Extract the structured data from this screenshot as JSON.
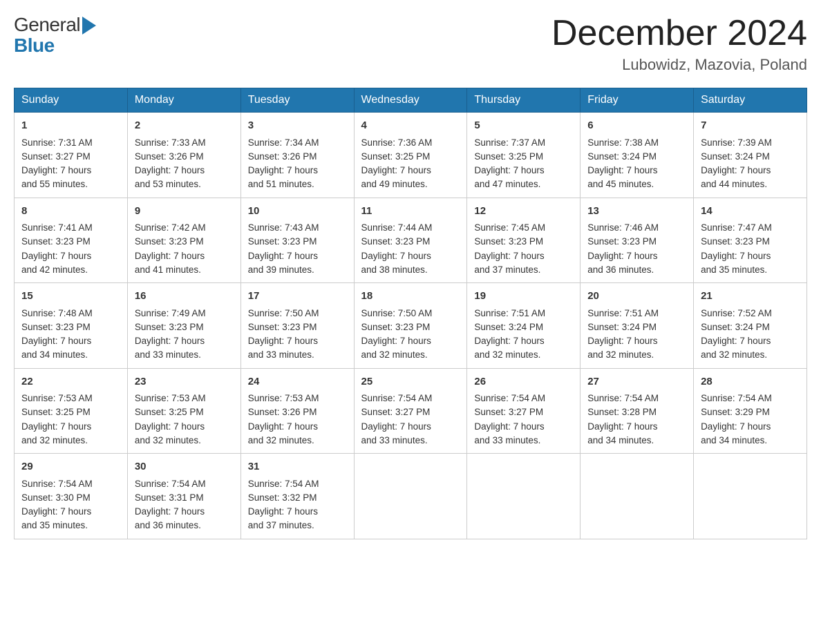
{
  "header": {
    "logo_general": "General",
    "logo_blue": "Blue",
    "month_title": "December 2024",
    "location": "Lubowidz, Mazovia, Poland"
  },
  "days_of_week": [
    "Sunday",
    "Monday",
    "Tuesday",
    "Wednesday",
    "Thursday",
    "Friday",
    "Saturday"
  ],
  "weeks": [
    [
      {
        "day": "1",
        "sunrise": "7:31 AM",
        "sunset": "3:27 PM",
        "daylight": "7 hours and 55 minutes."
      },
      {
        "day": "2",
        "sunrise": "7:33 AM",
        "sunset": "3:26 PM",
        "daylight": "7 hours and 53 minutes."
      },
      {
        "day": "3",
        "sunrise": "7:34 AM",
        "sunset": "3:26 PM",
        "daylight": "7 hours and 51 minutes."
      },
      {
        "day": "4",
        "sunrise": "7:36 AM",
        "sunset": "3:25 PM",
        "daylight": "7 hours and 49 minutes."
      },
      {
        "day": "5",
        "sunrise": "7:37 AM",
        "sunset": "3:25 PM",
        "daylight": "7 hours and 47 minutes."
      },
      {
        "day": "6",
        "sunrise": "7:38 AM",
        "sunset": "3:24 PM",
        "daylight": "7 hours and 45 minutes."
      },
      {
        "day": "7",
        "sunrise": "7:39 AM",
        "sunset": "3:24 PM",
        "daylight": "7 hours and 44 minutes."
      }
    ],
    [
      {
        "day": "8",
        "sunrise": "7:41 AM",
        "sunset": "3:23 PM",
        "daylight": "7 hours and 42 minutes."
      },
      {
        "day": "9",
        "sunrise": "7:42 AM",
        "sunset": "3:23 PM",
        "daylight": "7 hours and 41 minutes."
      },
      {
        "day": "10",
        "sunrise": "7:43 AM",
        "sunset": "3:23 PM",
        "daylight": "7 hours and 39 minutes."
      },
      {
        "day": "11",
        "sunrise": "7:44 AM",
        "sunset": "3:23 PM",
        "daylight": "7 hours and 38 minutes."
      },
      {
        "day": "12",
        "sunrise": "7:45 AM",
        "sunset": "3:23 PM",
        "daylight": "7 hours and 37 minutes."
      },
      {
        "day": "13",
        "sunrise": "7:46 AM",
        "sunset": "3:23 PM",
        "daylight": "7 hours and 36 minutes."
      },
      {
        "day": "14",
        "sunrise": "7:47 AM",
        "sunset": "3:23 PM",
        "daylight": "7 hours and 35 minutes."
      }
    ],
    [
      {
        "day": "15",
        "sunrise": "7:48 AM",
        "sunset": "3:23 PM",
        "daylight": "7 hours and 34 minutes."
      },
      {
        "day": "16",
        "sunrise": "7:49 AM",
        "sunset": "3:23 PM",
        "daylight": "7 hours and 33 minutes."
      },
      {
        "day": "17",
        "sunrise": "7:50 AM",
        "sunset": "3:23 PM",
        "daylight": "7 hours and 33 minutes."
      },
      {
        "day": "18",
        "sunrise": "7:50 AM",
        "sunset": "3:23 PM",
        "daylight": "7 hours and 32 minutes."
      },
      {
        "day": "19",
        "sunrise": "7:51 AM",
        "sunset": "3:24 PM",
        "daylight": "7 hours and 32 minutes."
      },
      {
        "day": "20",
        "sunrise": "7:51 AM",
        "sunset": "3:24 PM",
        "daylight": "7 hours and 32 minutes."
      },
      {
        "day": "21",
        "sunrise": "7:52 AM",
        "sunset": "3:24 PM",
        "daylight": "7 hours and 32 minutes."
      }
    ],
    [
      {
        "day": "22",
        "sunrise": "7:53 AM",
        "sunset": "3:25 PM",
        "daylight": "7 hours and 32 minutes."
      },
      {
        "day": "23",
        "sunrise": "7:53 AM",
        "sunset": "3:25 PM",
        "daylight": "7 hours and 32 minutes."
      },
      {
        "day": "24",
        "sunrise": "7:53 AM",
        "sunset": "3:26 PM",
        "daylight": "7 hours and 32 minutes."
      },
      {
        "day": "25",
        "sunrise": "7:54 AM",
        "sunset": "3:27 PM",
        "daylight": "7 hours and 33 minutes."
      },
      {
        "day": "26",
        "sunrise": "7:54 AM",
        "sunset": "3:27 PM",
        "daylight": "7 hours and 33 minutes."
      },
      {
        "day": "27",
        "sunrise": "7:54 AM",
        "sunset": "3:28 PM",
        "daylight": "7 hours and 34 minutes."
      },
      {
        "day": "28",
        "sunrise": "7:54 AM",
        "sunset": "3:29 PM",
        "daylight": "7 hours and 34 minutes."
      }
    ],
    [
      {
        "day": "29",
        "sunrise": "7:54 AM",
        "sunset": "3:30 PM",
        "daylight": "7 hours and 35 minutes."
      },
      {
        "day": "30",
        "sunrise": "7:54 AM",
        "sunset": "3:31 PM",
        "daylight": "7 hours and 36 minutes."
      },
      {
        "day": "31",
        "sunrise": "7:54 AM",
        "sunset": "3:32 PM",
        "daylight": "7 hours and 37 minutes."
      },
      null,
      null,
      null,
      null
    ]
  ],
  "labels": {
    "sunrise": "Sunrise:",
    "sunset": "Sunset:",
    "daylight": "Daylight:"
  }
}
